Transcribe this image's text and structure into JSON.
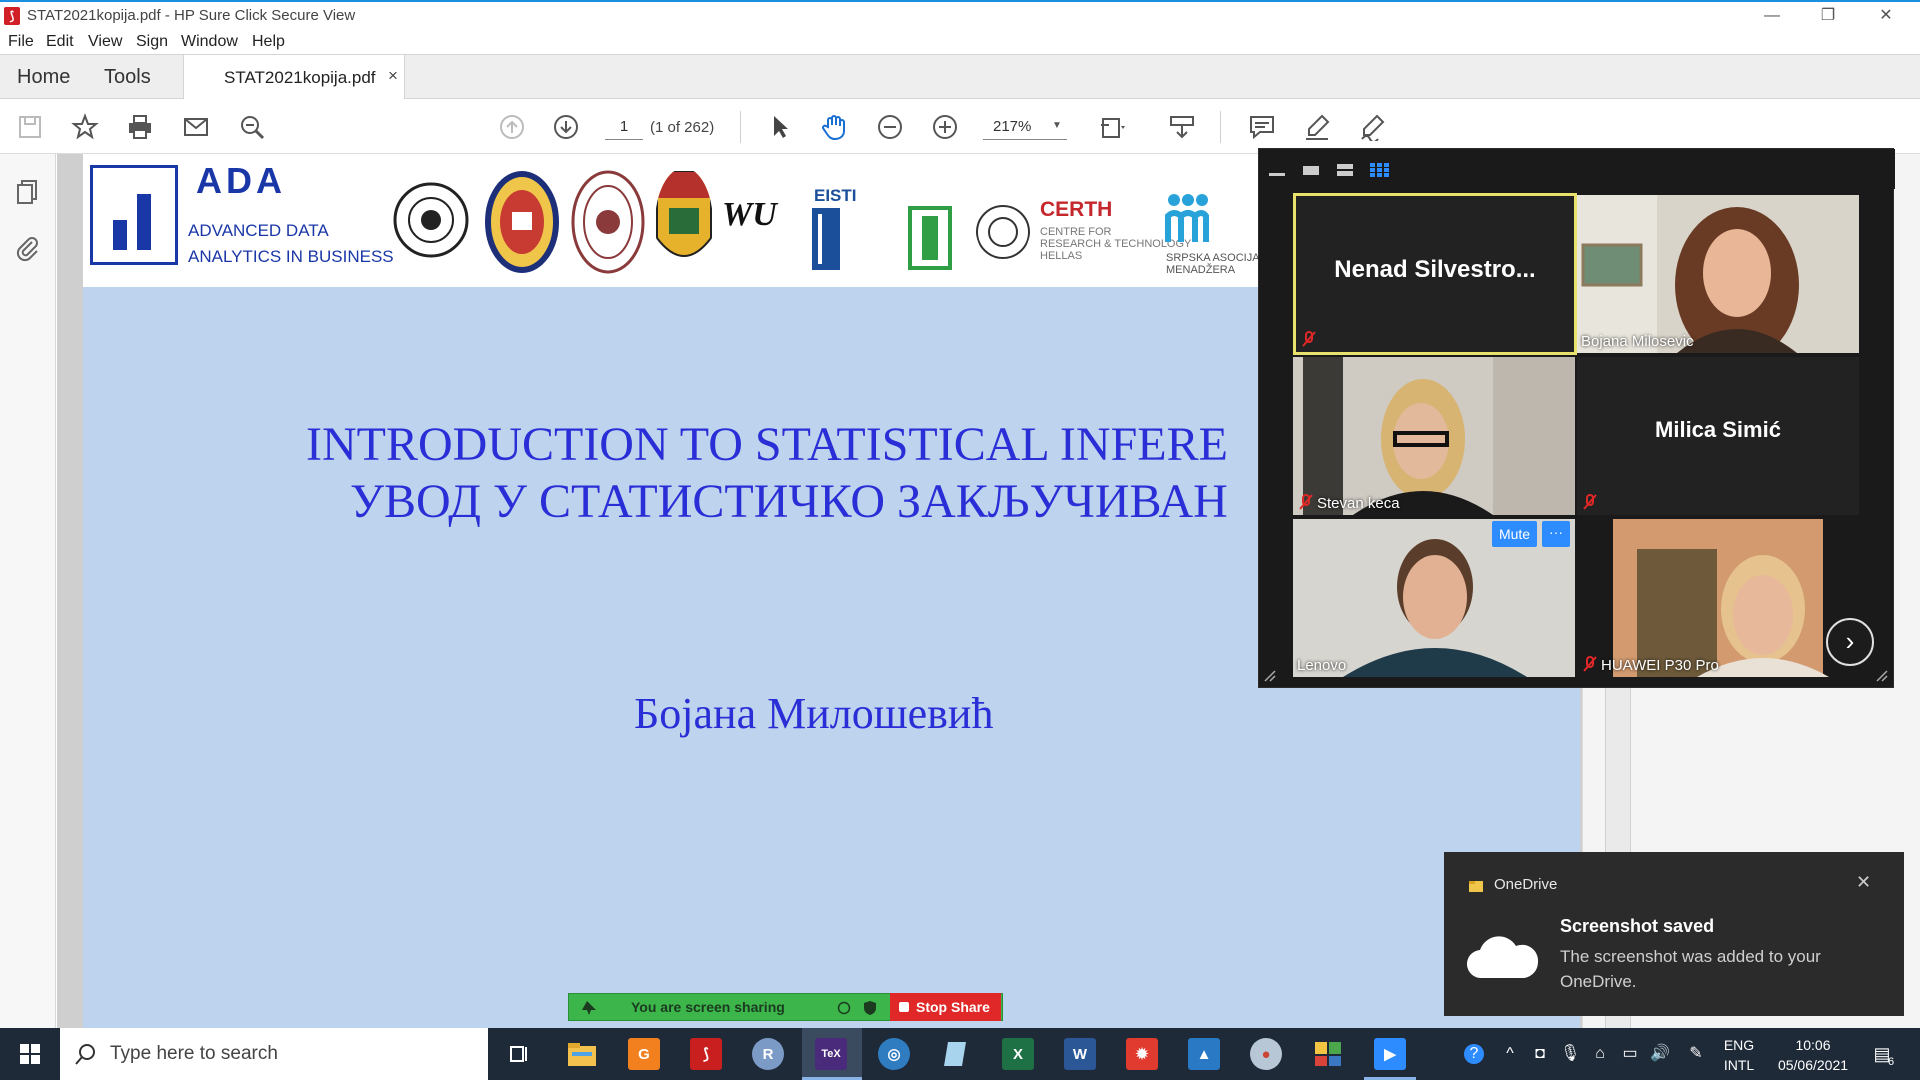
{
  "window": {
    "title": "STAT2021kopija.pdf - HP Sure Click Secure View",
    "minimize": "—",
    "maximize": "❐",
    "close": "✕"
  },
  "menu": [
    "File",
    "Edit",
    "View",
    "Sign",
    "Window",
    "Help"
  ],
  "tabs": {
    "home": "Home",
    "tools": "Tools",
    "document": "STAT2021kopija.pdf",
    "close": "×"
  },
  "toolbar": {
    "page_number": "1",
    "page_count": "(1 of 262)",
    "zoom": "217%"
  },
  "document": {
    "ada_title": "ADA",
    "ada_subtitle_line1": "ADVANCED DATA",
    "ada_subtitle_line2": "ANALYTICS IN BUSINESS",
    "logo_wu": "WU",
    "logo_eisti": "EISTI",
    "logo_certh": "CERTH",
    "logo_certh_sub1": "CENTRE FOR",
    "logo_certh_sub2": "RESEARCH & TECHNOLOGY",
    "logo_certh_sub3": "HELLAS",
    "logo_sam": "SRPSKA ASOCIJACIJA",
    "logo_sam2": "MENADŽERA",
    "title_line1": "INTRODUCTION TO STATISTICAL INFERE",
    "title_line2": "УВОД У СТАТИСТИЧКО ЗАКЉУЧИВАН",
    "author": "Бојана Милошевић"
  },
  "zoom": {
    "participants": [
      {
        "name": "Nenad  Silvestro...",
        "label": "",
        "muted": true,
        "video": false,
        "active": true
      },
      {
        "name": "",
        "label": "Bojana Milosevic",
        "muted": false,
        "video": true,
        "active": false
      },
      {
        "name": "",
        "label": "Stevan keca",
        "muted": true,
        "video": true,
        "active": false
      },
      {
        "name": "Milica Simić",
        "label": "",
        "muted": true,
        "video": false,
        "active": false
      },
      {
        "name": "",
        "label": "Lenovo",
        "muted": false,
        "video": true,
        "active": false
      },
      {
        "name": "",
        "label": "HUAWEI P30 Pro",
        "muted": true,
        "video": true,
        "active": false
      }
    ],
    "mute_button": "Mute",
    "more_button": "···",
    "next_button": "›"
  },
  "share_bar": {
    "status": "You are screen sharing",
    "stop": "Stop Share"
  },
  "toast": {
    "app": "OneDrive",
    "title": "Screenshot saved",
    "body": "The screenshot was added to your OneDrive.",
    "close": "✕"
  },
  "taskbar": {
    "search_placeholder": "Type here to search",
    "lang_line1": "ENG",
    "lang_line2": "INTL",
    "time": "10:06",
    "date": "05/06/2021",
    "notification_count": "6"
  },
  "colors": {
    "slide_background": "#bed3ee",
    "slide_text": "#2a2ed6",
    "accent_blue": "#1a37a8",
    "zoom_blue": "#2d8cff",
    "share_green": "#3cb54a",
    "stop_red": "#e02828",
    "active_speaker": "#e8e16b"
  }
}
